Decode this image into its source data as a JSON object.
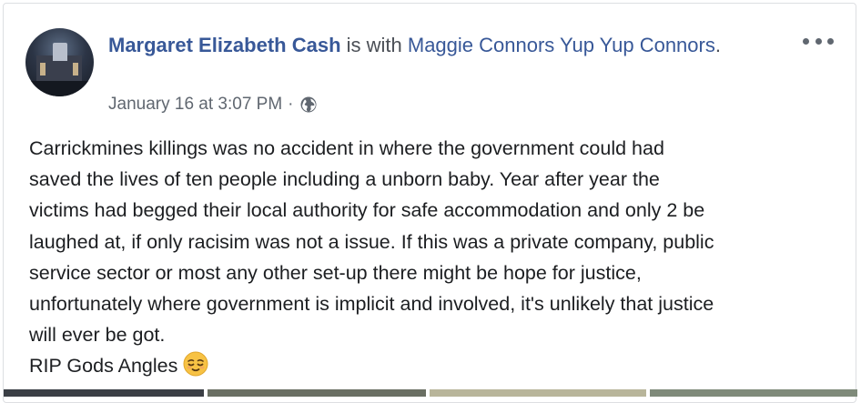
{
  "post": {
    "author": "Margaret Elizabeth Cash",
    "with_text": " is with ",
    "tagged": "Maggie Connors Yup Yup Connors",
    "tagged_suffix": ".",
    "timestamp": "January 16 at 3:07 PM",
    "separator": "·",
    "privacy_icon": "globe-icon",
    "more_icon": "more-options-icon",
    "body_lines": [
      "Carrickmines killings was no accident in where the government could had",
      "saved the lives of ten people including a unborn baby. Year after year the",
      "victims had begged their local authority for safe accommodation and only 2 be",
      "laughed at, if only racisim was not a issue. If this was a private company, public",
      "service sector or most any other set-up there might be hope for justice,",
      "unfortunately where government is implicit and involved, it's unlikely that justice",
      "will ever be got."
    ],
    "closing": "RIP Gods Angles",
    "emoji_icon": "relieved-face-emoji"
  },
  "colors": {
    "link": "#385898",
    "secondary_text": "#606770",
    "body_text": "#1c1e21",
    "border": "#dddfe2"
  }
}
